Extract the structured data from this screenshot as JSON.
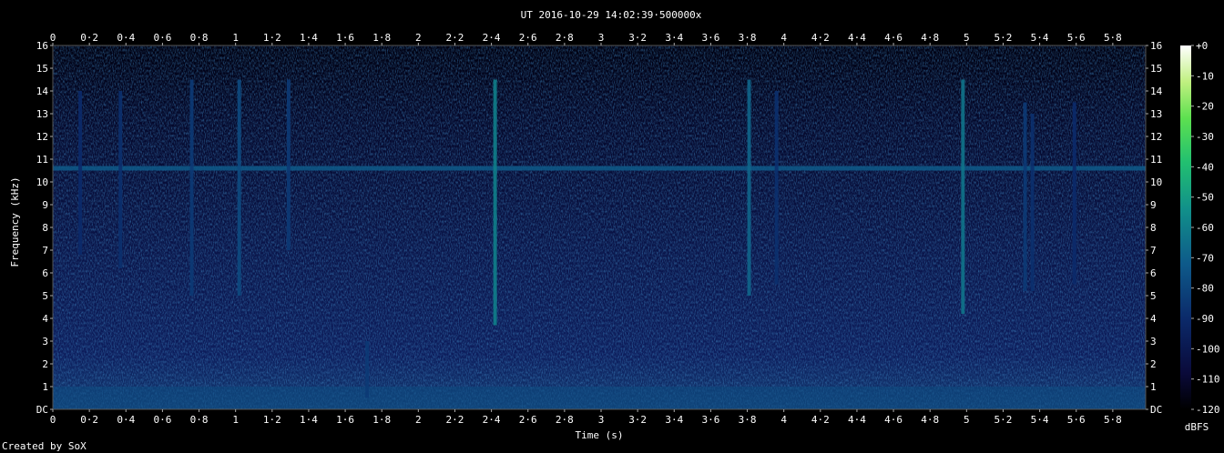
{
  "chart_data": {
    "type": "heatmap",
    "title": "UT 2016-10-29 14:02:39·500000x",
    "xlabel": "Time (s)",
    "ylabel": "Frequency (kHz)",
    "colorbar_label": "dBFS",
    "credit": "Created by SoX",
    "xlim": [
      0,
      5.98
    ],
    "ylim": [
      0,
      16
    ],
    "x_ticks": [
      "0",
      "0·2",
      "0·4",
      "0·6",
      "0·8",
      "1",
      "1·2",
      "1·4",
      "1·6",
      "1·8",
      "2",
      "2·2",
      "2·4",
      "2·6",
      "2·8",
      "3",
      "3·2",
      "3·4",
      "3·6",
      "3·8",
      "4",
      "4·2",
      "4·4",
      "4·6",
      "4·8",
      "5",
      "5·2",
      "5·4",
      "5·6",
      "5·8"
    ],
    "y_ticks": [
      "DC",
      "1",
      "2",
      "3",
      "4",
      "5",
      "6",
      "7",
      "8",
      "9",
      "10",
      "11",
      "12",
      "13",
      "14",
      "15",
      "16"
    ],
    "colorbar_ticks": [
      "+0",
      "-10",
      "-20",
      "-30",
      "-40",
      "-50",
      "-60",
      "-70",
      "-80",
      "-90",
      "-100",
      "-110",
      "-120"
    ],
    "colorbar_range": [
      -120,
      0
    ],
    "colormap": [
      "#000000",
      "#0a0a3a",
      "#0b2a6a",
      "#0e5a8a",
      "#11908a",
      "#22c070",
      "#5de050",
      "#c0f080",
      "#ffffff"
    ],
    "features": [
      {
        "name": "tone",
        "freq_khz": 10.6,
        "t_start": 0,
        "t_end": 5.98,
        "level_dbfs": -75
      },
      {
        "name": "low-frequency band",
        "freq_khz_range": [
          0,
          1.0
        ],
        "level_dbfs": -80
      },
      {
        "name": "broadband transient",
        "t": 0.15,
        "freq_khz_range": [
          6.8,
          14.0
        ],
        "level_dbfs": -90
      },
      {
        "name": "broadband transient",
        "t": 0.37,
        "freq_khz_range": [
          6.2,
          14.0
        ],
        "level_dbfs": -88
      },
      {
        "name": "broadband transient",
        "t": 0.76,
        "freq_khz_range": [
          5.0,
          14.5
        ],
        "level_dbfs": -85
      },
      {
        "name": "broadband transient",
        "t": 1.02,
        "freq_khz_range": [
          5.0,
          14.5
        ],
        "level_dbfs": -80
      },
      {
        "name": "broadband transient",
        "t": 1.29,
        "freq_khz_range": [
          7.0,
          14.5
        ],
        "level_dbfs": -85
      },
      {
        "name": "broadband transient",
        "t": 1.72,
        "freq_khz_range": [
          0.5,
          3.0
        ],
        "level_dbfs": -85
      },
      {
        "name": "broadband transient",
        "t": 2.42,
        "freq_khz_range": [
          3.7,
          14.5
        ],
        "level_dbfs": -65
      },
      {
        "name": "broadband transient",
        "t": 3.81,
        "freq_khz_range": [
          5.0,
          14.5
        ],
        "level_dbfs": -72
      },
      {
        "name": "broadband transient",
        "t": 3.96,
        "freq_khz_range": [
          5.5,
          14.0
        ],
        "level_dbfs": -88
      },
      {
        "name": "broadband transient",
        "t": 4.98,
        "freq_khz_range": [
          4.2,
          14.5
        ],
        "level_dbfs": -68
      },
      {
        "name": "broadband transient",
        "t": 5.32,
        "freq_khz_range": [
          5.2,
          13.5
        ],
        "level_dbfs": -85
      },
      {
        "name": "broadband transient",
        "t": 5.36,
        "freq_khz_range": [
          5.2,
          13.0
        ],
        "level_dbfs": -88
      },
      {
        "name": "broadband transient",
        "t": 5.59,
        "freq_khz_range": [
          5.5,
          13.5
        ],
        "level_dbfs": -90
      }
    ]
  }
}
